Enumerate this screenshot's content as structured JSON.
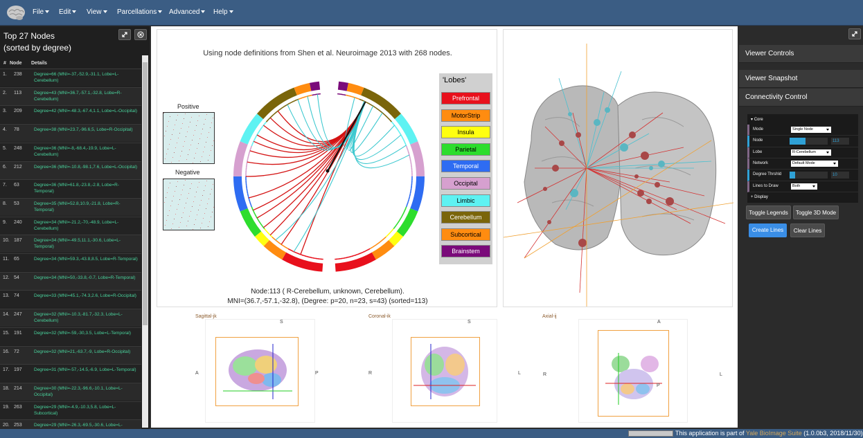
{
  "menu": [
    "File",
    "Edit",
    "View",
    "Parcellations",
    "Advanced",
    "Help"
  ],
  "left_panel": {
    "title_line1": "Top 27 Nodes",
    "title_line2": "(sorted by degree)",
    "col_rank": "#",
    "col_node": "Node",
    "col_details": "Details",
    "rows": [
      {
        "rank": "1.",
        "node": "238",
        "details": "Degree=66 (MNI=-37,-52.9,-31.1, Lobe=L-Cerebellum)"
      },
      {
        "rank": "2.",
        "node": "113",
        "details": "Degree=43 (MNI=36.7,-57.1,-32.8, Lobe=R-Cerebellum)"
      },
      {
        "rank": "3.",
        "node": "209",
        "details": "Degree=42 (MNI=-48.3,-67.4,1.1, Lobe=L-Occipital)"
      },
      {
        "rank": "4.",
        "node": "78",
        "details": "Degree=38 (MNI=23.7,-96.6,5, Lobe=R-Occipital)"
      },
      {
        "rank": "5.",
        "node": "248",
        "details": "Degree=36 (MNI=-8,-68.4,-19.9, Lobe=L-Cerebellum)"
      },
      {
        "rank": "6.",
        "node": "212",
        "details": "Degree=36 (MNI=-10.8,-98.1,7.6, Lobe=L-Occipital)"
      },
      {
        "rank": "7.",
        "node": "63",
        "details": "Degree=36 (MNI=61.8,-23.8,-2.8, Lobe=R-Temporal)"
      },
      {
        "rank": "8.",
        "node": "53",
        "details": "Degree=35 (MNI=52.8,10.9,-21.8, Lobe=R-Temporal)"
      },
      {
        "rank": "9.",
        "node": "240",
        "details": "Degree=34 (MNI=-21.2,-70,-48.9, Lobe=L-Cerebellum)"
      },
      {
        "rank": "10.",
        "node": "187",
        "details": "Degree=34 (MNI=-49.5,11.1,-30.6, Lobe=L-Temporal)"
      },
      {
        "rank": "11.",
        "node": "65",
        "details": "Degree=34 (MNI=59.3,-43.8,8.5, Lobe=R-Temporal)"
      },
      {
        "rank": "12.",
        "node": "54",
        "details": "Degree=34 (MNI=50,-33.8,-0.7, Lobe=R-Temporal)"
      },
      {
        "rank": "13.",
        "node": "74",
        "details": "Degree=33 (MNI=45.1,-74.3,2.6, Lobe=R-Occipital)"
      },
      {
        "rank": "14.",
        "node": "247",
        "details": "Degree=32 (MNI=-10.3,-81.7,-32.3, Lobe=L-Cerebellum)"
      },
      {
        "rank": "15.",
        "node": "191",
        "details": "Degree=32 (MNI=-59,-30,3.5, Lobe=L-Temporal)"
      },
      {
        "rank": "16.",
        "node": "72",
        "details": "Degree=32 (MNI=21,-63.7,-9, Lobe=R-Occipital)"
      },
      {
        "rank": "17.",
        "node": "197",
        "details": "Degree=31 (MNI=-57,-14.5,-6.9, Lobe=L-Temporal)"
      },
      {
        "rank": "18.",
        "node": "214",
        "details": "Degree=30 (MNI=-22.3,-96.6,-10.1, Lobe=L-Occipital)"
      },
      {
        "rank": "19.",
        "node": "263",
        "details": "Degree=29 (MNI=-4.9,-10.3,5.8, Lobe=L-Subcortical)"
      },
      {
        "rank": "20.",
        "node": "253",
        "details": "Degree=29 (MNI=-26.3,-69.5,-30.6, Lobe=L-Cerebellum)"
      }
    ]
  },
  "connectogram": {
    "heading": "Using node definitions from Shen et al. Neuroimage 2013 with 268 nodes.",
    "positive_label": "Positive",
    "negative_label": "Negative",
    "legend_title": "'Lobes'",
    "lobes": [
      {
        "name": "Prefrontal",
        "color": "#e8101c",
        "text": "#ffffff"
      },
      {
        "name": "MotorStrip",
        "color": "#ff8c10",
        "text": "#000000"
      },
      {
        "name": "Insula",
        "color": "#ffff10",
        "text": "#000000"
      },
      {
        "name": "Parietal",
        "color": "#2ddd2d",
        "text": "#000000"
      },
      {
        "name": "Temporal",
        "color": "#2e6cf2",
        "text": "#ffffff"
      },
      {
        "name": "Occipital",
        "color": "#d6a0cf",
        "text": "#000000"
      },
      {
        "name": "Limbic",
        "color": "#5ef2f2",
        "text": "#000000"
      },
      {
        "name": "Cerebellum",
        "color": "#7a650a",
        "text": "#ffffff"
      },
      {
        "name": "Subcortical",
        "color": "#ff8c10",
        "text": "#000000"
      },
      {
        "name": "Brainstem",
        "color": "#7a0a7a",
        "text": "#ffffff"
      }
    ],
    "caption_line1": "Node:113 ( R-Cerebellum, unknown, Cerebellum).",
    "caption_line2": "MNI=(36.7,-57.1,-32.8), (Degree: p=20, n=23, s=43)  (sorted=113)"
  },
  "slices": {
    "sagittal": {
      "label": "Sagittal-jk",
      "top": "S",
      "left": "A",
      "right": "P"
    },
    "coronal": {
      "label": "Coronal-ik",
      "top": "S",
      "left": "R",
      "right": "L"
    },
    "axial": {
      "label": "Axial-ij",
      "top": "A",
      "left": "R",
      "right": "L",
      "marker": "P"
    }
  },
  "right_panel": {
    "viewer_controls": "Viewer Controls",
    "viewer_snapshot": "Viewer Snapshot",
    "connectivity_control": "Connectivity Control",
    "gui": {
      "core_label": "Core",
      "mode_label": "Mode",
      "mode_value": "Single Node",
      "node_label": "Node",
      "node_value": "113",
      "node_fraction": 0.42,
      "lobe_label": "Lobe",
      "lobe_value": "R-Cerebellum",
      "network_label": "Network",
      "network_value": "Default Mode",
      "degree_label": "Degree Thrshld",
      "degree_value": "10",
      "degree_fraction": 0.15,
      "lines_label": "Lines to Draw",
      "lines_value": "Both",
      "display_label": "Display"
    },
    "buttons": {
      "toggle_legends": "Toggle Legends",
      "toggle_3d": "Toggle 3D Mode",
      "create_lines": "Create Lines",
      "clear_lines": "Clear Lines"
    }
  },
  "footer": {
    "text": "This application is part of ",
    "link": "Yale BioImage Suite",
    "version": " (1.0.0b3, 2018/11/30)"
  }
}
